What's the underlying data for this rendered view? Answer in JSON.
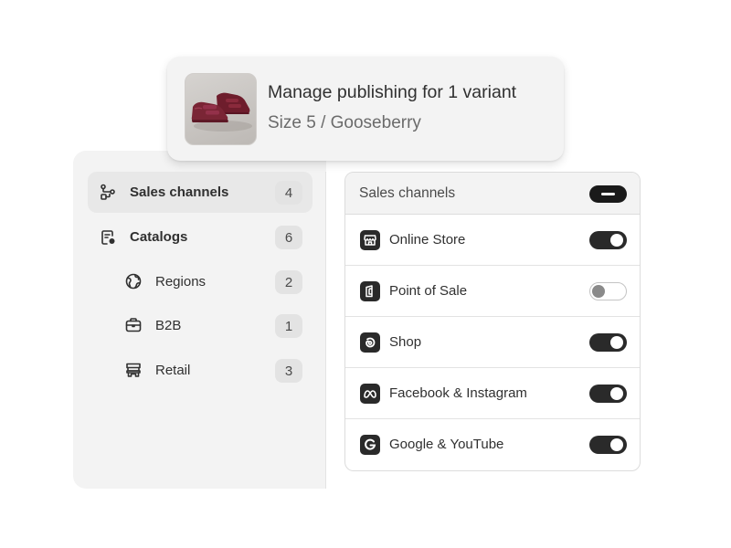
{
  "variant": {
    "title": "Manage publishing for 1 variant",
    "subtitle": "Size 5 / Gooseberry",
    "thumbnail_icon": "shoe-product-image"
  },
  "sidebar": {
    "items": [
      {
        "label": "Sales channels",
        "count": "4",
        "icon": "sales-channels-icon",
        "active": true
      },
      {
        "label": "Catalogs",
        "count": "6",
        "icon": "catalog-icon",
        "active": false
      },
      {
        "label": "Regions",
        "count": "2",
        "icon": "globe-icon",
        "active": false
      },
      {
        "label": "B2B",
        "count": "1",
        "icon": "briefcase-icon",
        "active": false
      },
      {
        "label": "Retail",
        "count": "3",
        "icon": "store-icon",
        "active": false
      }
    ]
  },
  "channels": {
    "header_label": "Sales channels",
    "master_state": "indeterminate",
    "items": [
      {
        "label": "Online Store",
        "icon": "online-store-icon",
        "enabled": true
      },
      {
        "label": "Point of Sale",
        "icon": "point-of-sale-icon",
        "enabled": false
      },
      {
        "label": "Shop",
        "icon": "shop-icon",
        "enabled": true
      },
      {
        "label": "Facebook & Instagram",
        "icon": "meta-icon",
        "enabled": true
      },
      {
        "label": "Google & YouTube",
        "icon": "google-icon",
        "enabled": true
      }
    ]
  },
  "colors": {
    "toggle_on": "#2a2a2a",
    "panel_bg": "#f3f3f3",
    "product_color": "#7a2535"
  }
}
